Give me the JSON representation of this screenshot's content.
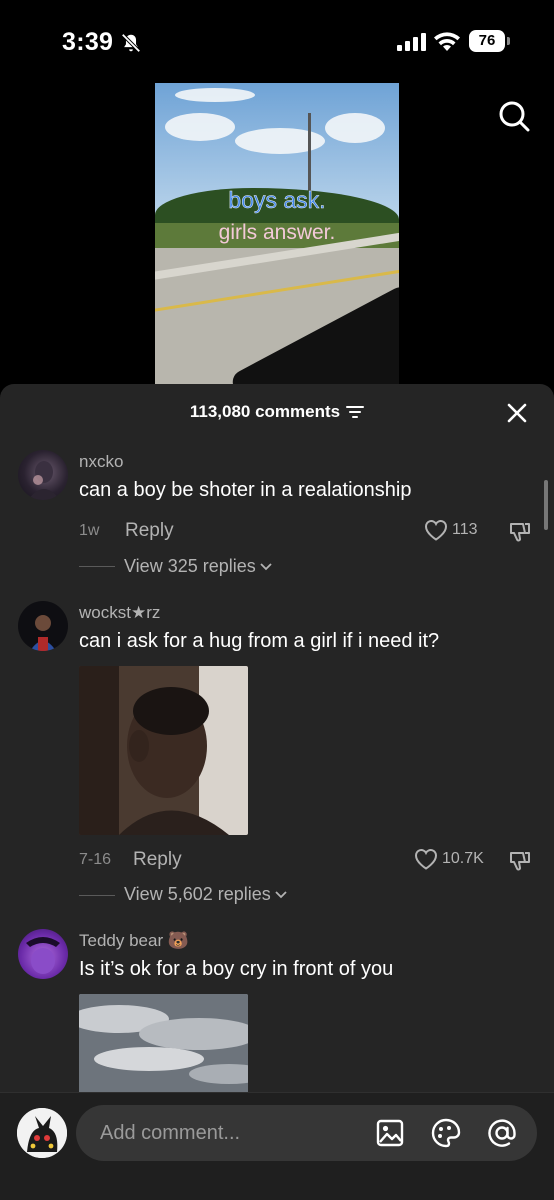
{
  "status_bar": {
    "time": "3:39",
    "battery": "76"
  },
  "video": {
    "overlay_line1": "boys ask.",
    "overlay_line2": "girls answer."
  },
  "comments_panel": {
    "count_label": "113,080 comments",
    "comments": [
      {
        "username": "nxcko",
        "text": "can a boy be shoter in a realationship",
        "time": "1w",
        "reply_label": "Reply",
        "likes": "113",
        "view_replies": "View 325 replies"
      },
      {
        "username": "wockst★rz",
        "text": "can i ask for a hug from a girl if i need it?",
        "time": "7-16",
        "reply_label": "Reply",
        "likes": "10.7K",
        "view_replies": "View 5,602 replies"
      },
      {
        "username": "Teddy bear 🐻",
        "text": "Is it’s ok for a boy cry in front of you"
      }
    ]
  },
  "bottom_bar": {
    "placeholder": "Add comment..."
  },
  "colors": {
    "panel_bg": "#252525",
    "secondary_text": "#b3b3b3",
    "overlay_blue": "#3f86e8",
    "overlay_pink": "#f3c9d8"
  },
  "icons": [
    "bell-muted-icon",
    "signal-icon",
    "wifi-icon",
    "search-icon",
    "filter-icon",
    "close-icon",
    "heart-icon",
    "dislike-icon",
    "chevron-down-icon",
    "image-icon",
    "sticker-icon",
    "mention-icon"
  ]
}
